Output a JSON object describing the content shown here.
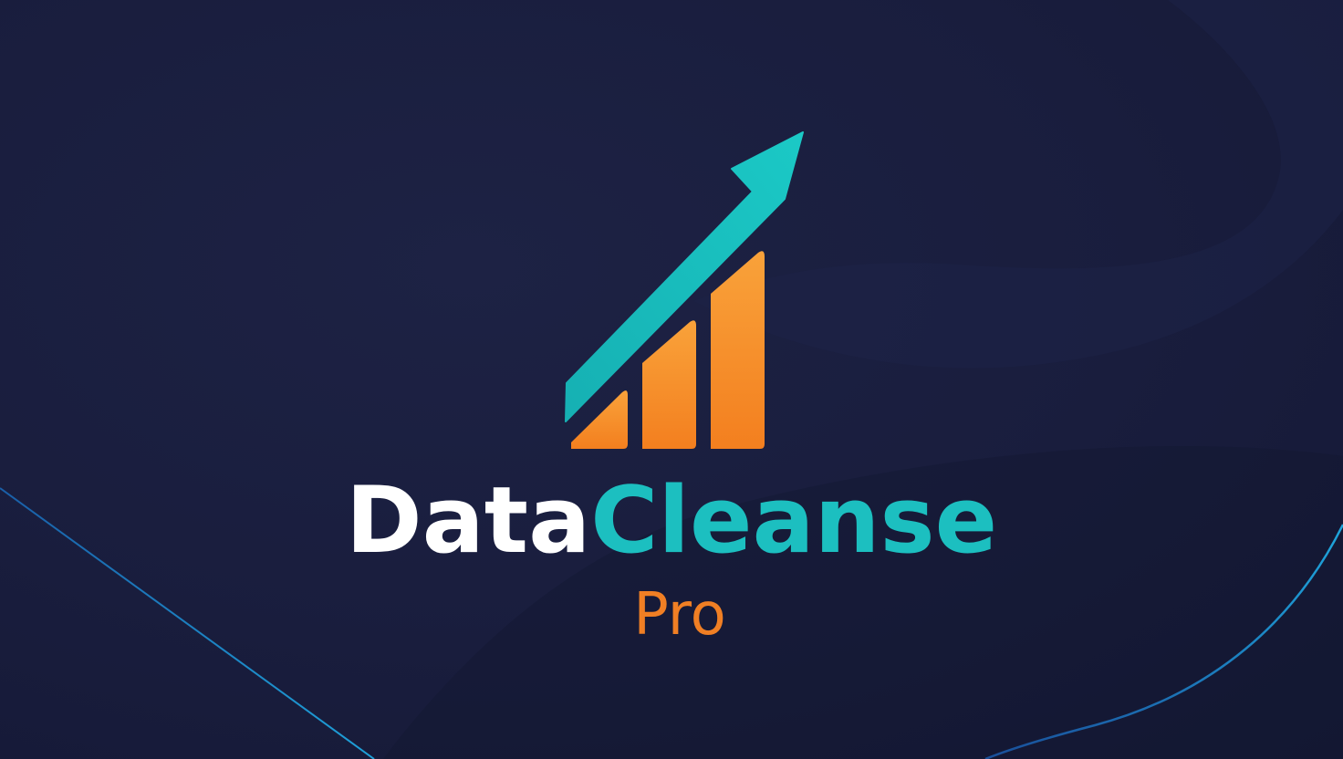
{
  "logo": {
    "word_primary": "Data",
    "word_secondary": "Cleanse",
    "subtitle": "Pro"
  },
  "colors": {
    "background": "#191d3d",
    "white_text": "#ffffff",
    "teal_accent": "#1cbfc0",
    "orange_accent": "#f07f24",
    "line_accent": "#1e88c8"
  },
  "icons": {
    "mark": "bar-chart-growth-arrow-icon"
  }
}
